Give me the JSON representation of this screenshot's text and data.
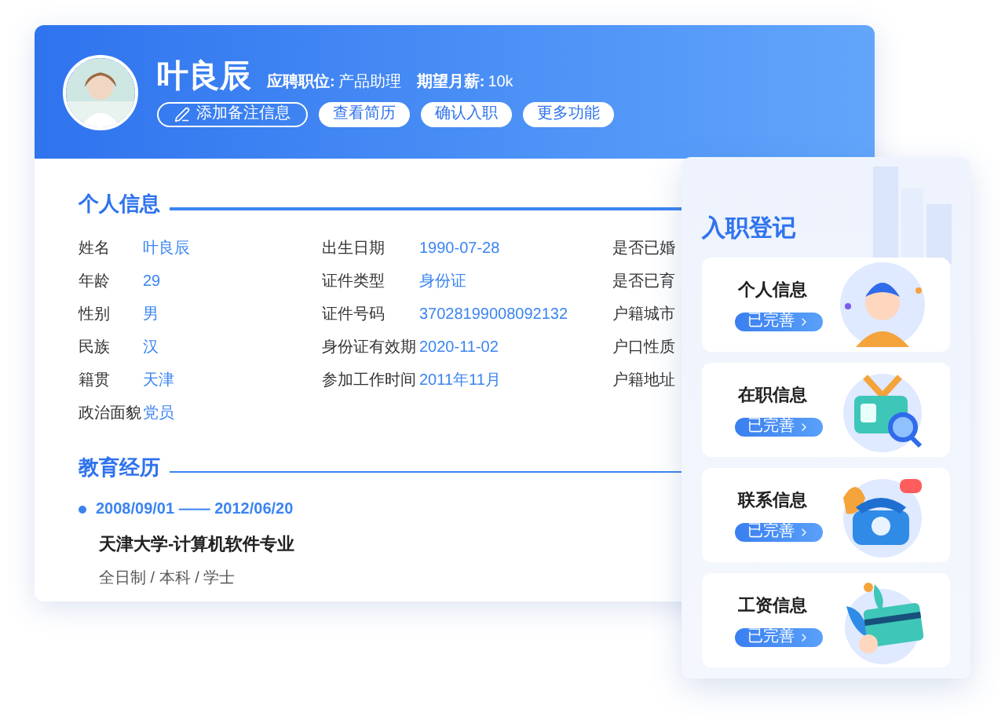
{
  "candidate": {
    "name": "叶良辰",
    "meta": [
      {
        "label": "应聘职位:",
        "value": "产品助理"
      },
      {
        "label": "期望月薪:",
        "value": "10k"
      }
    ]
  },
  "header_buttons": [
    {
      "label": "添加备注信息",
      "kind": "outline"
    },
    {
      "label": "查看简历",
      "kind": "solid"
    },
    {
      "label": "确认入职",
      "kind": "solid"
    },
    {
      "label": "更多功能",
      "kind": "solid"
    }
  ],
  "personal_info": {
    "title": "个人信息",
    "columns": [
      [
        {
          "label": "姓名",
          "value": "叶良辰"
        },
        {
          "label": "年龄",
          "value": "29"
        },
        {
          "label": "性别",
          "value": "男"
        },
        {
          "label": "民族",
          "value": "汉"
        },
        {
          "label": "籍贯",
          "value": "天津"
        },
        {
          "label": "政治面貌",
          "value": "党员"
        }
      ],
      [
        {
          "label": "出生日期",
          "value": "1990-07-28"
        },
        {
          "label": "证件类型",
          "value": "身份证"
        },
        {
          "label": "证件号码",
          "value": "37028199008092132"
        },
        {
          "label": "身份证有效期",
          "value": "2020-11-02"
        },
        {
          "label": "参加工作时间",
          "value": "2011年11月"
        }
      ],
      [
        {
          "label": "是否已婚"
        },
        {
          "label": "是否已育"
        },
        {
          "label": "户籍城市"
        },
        {
          "label": "户口性质"
        },
        {
          "label": "户籍地址"
        }
      ]
    ]
  },
  "education": {
    "title": "教育经历",
    "entries": [
      {
        "start": "2008/09/01",
        "separator": "——",
        "end": "2012/06/20",
        "school": "天津大学-计算机软件专业",
        "detail": "全日制 / 本科 / 学士"
      }
    ]
  },
  "onboarding": {
    "title": "入职登记",
    "sections": [
      {
        "title": "个人信息",
        "status": "已完善",
        "kind": "person"
      },
      {
        "title": "在职信息",
        "status": "已完善",
        "kind": "id-card"
      },
      {
        "title": "联系信息",
        "status": "已完善",
        "kind": "telephone"
      },
      {
        "title": "工资信息",
        "status": "已完善",
        "kind": "bank-card"
      }
    ]
  }
}
